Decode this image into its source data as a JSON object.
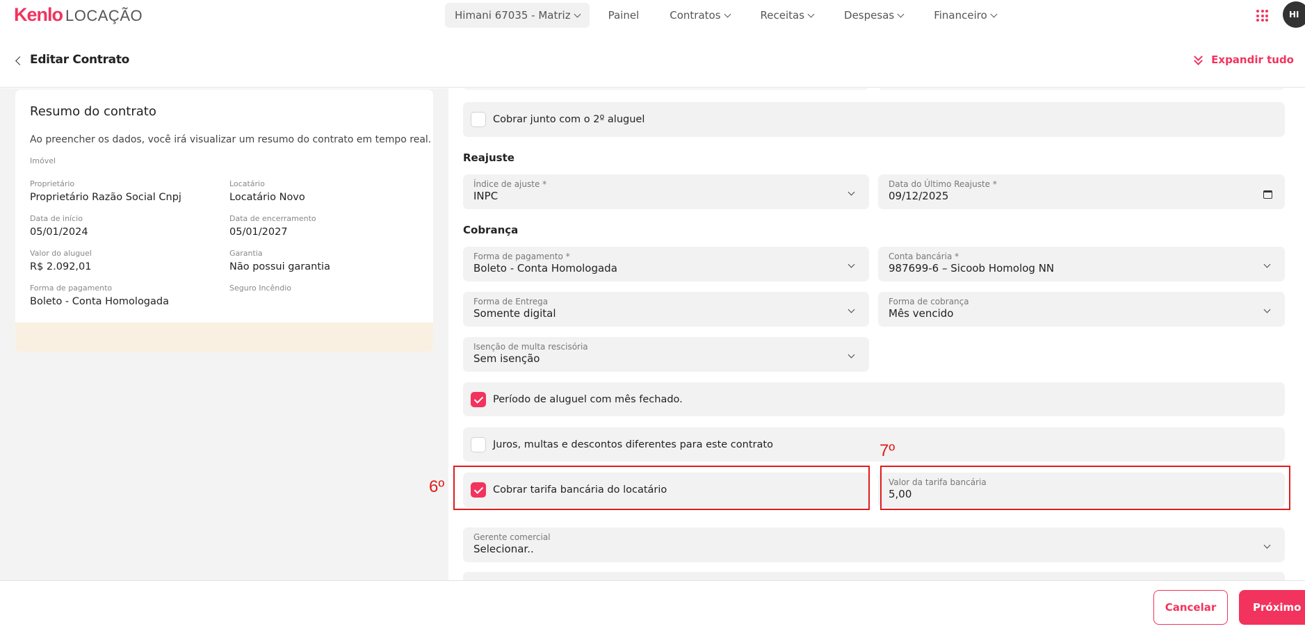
{
  "brand": {
    "name": "Kenlo",
    "product": "LOCAÇÃO"
  },
  "nav": {
    "branch": "Himani 67035 - Matriz",
    "items": [
      "Painel",
      "Contratos",
      "Receitas",
      "Despesas",
      "Financeiro"
    ]
  },
  "user": {
    "initials": "HI"
  },
  "header": {
    "title": "Editar Contrato",
    "expand_label": "Expandir tudo"
  },
  "summary": {
    "title": "Resumo do contrato",
    "description": "Ao preencher os dados, você irá visualizar um resumo do contrato em tempo real.",
    "property_label": "Imóvel",
    "owner_label": "Proprietário",
    "owner_value": "Proprietário Razão Social Cnpj",
    "tenant_label": "Locatário",
    "tenant_value": "Locatário Novo",
    "start_label": "Data de início",
    "start_value": "05/01/2024",
    "end_label": "Data de encerramento",
    "end_value": "05/01/2027",
    "rent_label": "Valor do aluguel",
    "rent_value": "R$ 2.092,01",
    "guarantee_label": "Garantia",
    "guarantee_value": "Não possui garantia",
    "payment_label": "Forma de pagamento",
    "payment_value": "Boleto - Conta Homologada",
    "insurance_label": "Seguro Incêndio"
  },
  "form": {
    "charge_with_2nd_rent": {
      "label": "Cobrar junto com o 2º aluguel",
      "checked": false
    },
    "readjust": {
      "section": "Reajuste",
      "index_label": "Índice de ajuste *",
      "index_value": "INPC",
      "last_date_label": "Data do Último Reajuste *",
      "last_date_value": "09/12/2025"
    },
    "billing": {
      "section": "Cobrança",
      "payment_label": "Forma de pagamento *",
      "payment_value": "Boleto - Conta Homologada",
      "bank_label": "Conta bancária *",
      "bank_value": "987699-6 – Sicoob Homolog NN",
      "delivery_label": "Forma de Entrega",
      "delivery_value": "Somente digital",
      "charge_type_label": "Forma de cobrança",
      "charge_type_value": "Mês vencido",
      "exemption_label": "Isenção de multa rescisória",
      "exemption_value": "Sem isenção"
    },
    "closed_month": {
      "label": "Período de aluguel com mês fechado.",
      "checked": true
    },
    "custom_fees": {
      "label": "Juros, multas e descontos diferentes para este contrato",
      "checked": false
    },
    "bank_fee": {
      "label": "Cobrar tarifa bancária do locatário",
      "checked": true
    },
    "bank_fee_value": {
      "label": "Valor da tarifa bancária",
      "value": "5,00"
    },
    "manager": {
      "label": "Gerente comercial",
      "value": "Selecionar.."
    }
  },
  "annotations": {
    "step6": "6º",
    "step7": "7º"
  },
  "footer": {
    "cancel": "Cancelar",
    "next": "Próximo"
  },
  "colors": {
    "accent": "#f2335d",
    "annotation": "#e01b1b",
    "summary_footer": "#faf0e2"
  }
}
